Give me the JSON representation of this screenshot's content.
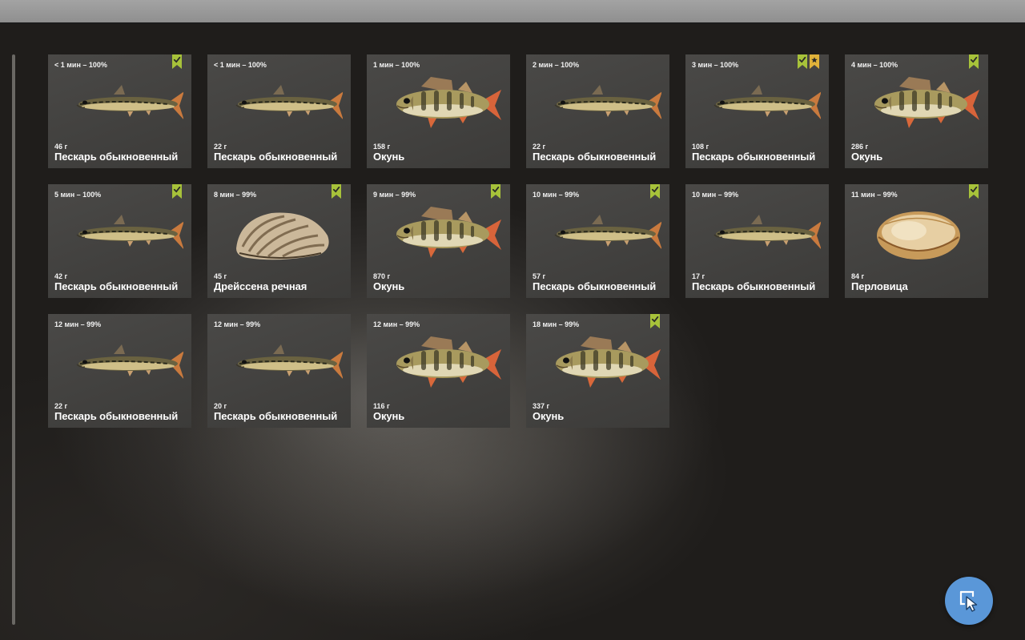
{
  "catches": [
    {
      "time": "< 1 мин – 100%",
      "weight": "46 г",
      "name": "Пескарь обыкновенный",
      "kind": "gudgeon",
      "badges": [
        "check"
      ]
    },
    {
      "time": "< 1 мин – 100%",
      "weight": "22 г",
      "name": "Пескарь обыкновенный",
      "kind": "gudgeon",
      "badges": []
    },
    {
      "time": "1 мин – 100%",
      "weight": "158 г",
      "name": "Окунь",
      "kind": "perch",
      "badges": []
    },
    {
      "time": "2 мин – 100%",
      "weight": "22 г",
      "name": "Пескарь обыкновенный",
      "kind": "gudgeon",
      "badges": []
    },
    {
      "time": "3 мин – 100%",
      "weight": "108 г",
      "name": "Пескарь обыкновенный",
      "kind": "gudgeon",
      "badges": [
        "check",
        "star"
      ]
    },
    {
      "time": "4 мин – 100%",
      "weight": "286 г",
      "name": "Окунь",
      "kind": "perch",
      "badges": [
        "check"
      ]
    },
    {
      "time": "5 мин – 100%",
      "weight": "42 г",
      "name": "Пескарь обыкновенный",
      "kind": "gudgeon",
      "badges": [
        "check"
      ]
    },
    {
      "time": "8 мин – 99%",
      "weight": "45 г",
      "name": "Дрейссена речная",
      "kind": "mussel",
      "badges": [
        "check"
      ]
    },
    {
      "time": "9 мин – 99%",
      "weight": "870 г",
      "name": "Окунь",
      "kind": "perch",
      "badges": [
        "check"
      ]
    },
    {
      "time": "10 мин – 99%",
      "weight": "57 г",
      "name": "Пескарь обыкновенный",
      "kind": "gudgeon",
      "badges": [
        "check"
      ]
    },
    {
      "time": "10 мин – 99%",
      "weight": "17 г",
      "name": "Пескарь обыкновенный",
      "kind": "gudgeon",
      "badges": []
    },
    {
      "time": "11 мин – 99%",
      "weight": "84 г",
      "name": "Перловица",
      "kind": "clam",
      "badges": [
        "check"
      ]
    },
    {
      "time": "12 мин – 99%",
      "weight": "22 г",
      "name": "Пескарь обыкновенный",
      "kind": "gudgeon",
      "badges": []
    },
    {
      "time": "12 мин – 99%",
      "weight": "20 г",
      "name": "Пескарь обыкновенный",
      "kind": "gudgeon",
      "badges": []
    },
    {
      "time": "12 мин – 99%",
      "weight": "116 г",
      "name": "Окунь",
      "kind": "perch",
      "badges": []
    },
    {
      "time": "18 мин – 99%",
      "weight": "337 г",
      "name": "Окунь",
      "kind": "perch",
      "badges": [
        "check"
      ]
    }
  ],
  "colors": {
    "badge_check": "#a7c23a",
    "badge_star": "#e0b23a",
    "fab": "#5a97d8"
  },
  "fab_icon": "cursor-select-icon"
}
